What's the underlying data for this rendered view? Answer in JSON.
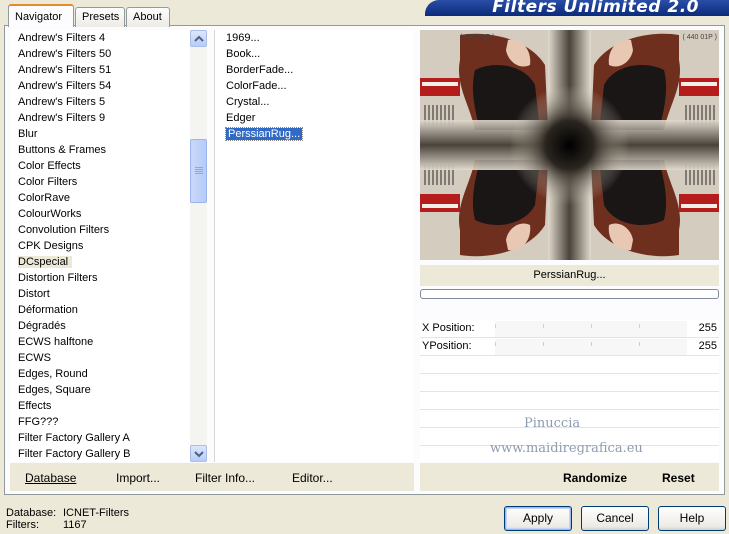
{
  "banner": {
    "title": "Filters Unlimited 2.0"
  },
  "tabs": [
    {
      "label": "Navigator",
      "active": true
    },
    {
      "label": "Presets",
      "active": false
    },
    {
      "label": "About",
      "active": false
    }
  ],
  "categories": [
    "Andrew's Filters 4",
    "Andrew's Filters 50",
    "Andrew's Filters 51",
    "Andrew's Filters 54",
    "Andrew's Filters 5",
    "Andrew's Filters 9",
    "Blur",
    "Buttons & Frames",
    "Color Effects",
    "Color Filters",
    "ColorRave",
    "ColourWorks",
    "Convolution Filters",
    "CPK Designs",
    "DCspecial",
    "Distortion Filters",
    "Distort",
    "Déformation",
    "Dégradés",
    "ECWS halftone",
    "ECWS",
    "Edges, Round",
    "Edges, Square",
    "Effects",
    "FFG???",
    "Filter Factory Gallery A",
    "Filter Factory Gallery B"
  ],
  "selected_category": "DCspecial",
  "filters": [
    "1969...",
    "Book...",
    "BorderFade...",
    "ColorFade...",
    "Crystal...",
    "Edger",
    "PerssianRug..."
  ],
  "selected_filter": "PerssianRug...",
  "left_actions": {
    "database": "Database",
    "import": "Import...",
    "filter_info": "Filter Info...",
    "editor": "Editor..."
  },
  "preview": {
    "filter_name": "PerssianRug...",
    "corner_text": "( 440 01P )"
  },
  "params": [
    {
      "label": "X Position:",
      "value": "255"
    },
    {
      "label": "YPosition:",
      "value": "255"
    }
  ],
  "watermark": {
    "line1": "Pinuccia",
    "line2": "www.maidiregrafica.eu"
  },
  "right_actions": {
    "randomize": "Randomize",
    "reset": "Reset"
  },
  "status": {
    "database_label": "Database:",
    "database_value": "ICNET-Filters",
    "filters_label": "Filters:",
    "filters_value": "1167"
  },
  "buttons": {
    "apply": "Apply",
    "cancel": "Cancel",
    "help": "Help"
  },
  "colors": {
    "selection": "#316ac5",
    "banner": "#0b2a7a",
    "face": "#ece9d8",
    "tab_accent": "#e68b2c"
  }
}
